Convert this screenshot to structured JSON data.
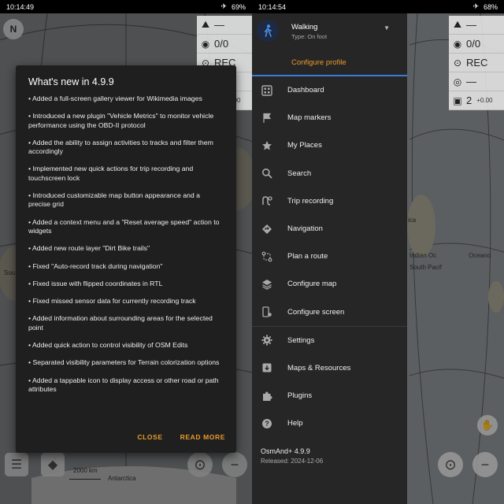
{
  "left": {
    "status": {
      "time": "10:14:49",
      "battery": "69%"
    },
    "widgets": [
      {
        "icon": "altitude-icon",
        "value": "—",
        "small": ""
      },
      {
        "icon": "distance-icon",
        "value": "0/0",
        "small": ""
      },
      {
        "icon": "record-icon",
        "value": "REC",
        "small": ""
      },
      {
        "icon": "time-icon",
        "value": "—",
        "small": ""
      },
      {
        "icon": "layers-icon",
        "value": "2",
        "small": "+0.00"
      }
    ],
    "compass": "N",
    "map_labels": {
      "antarctica": "Antarctica",
      "scale": "2000 km",
      "south": "Sou"
    },
    "dialog": {
      "title": "What's new in 4.9.9",
      "items": [
        "• Added a full-screen gallery viewer for Wikimedia images",
        "• Introduced a new plugin \"Vehicle Metrics\" to monitor vehicle performance using the OBD-II protocol",
        "• Added the ability to assign activities to tracks and filter them accordingly",
        "• Implemented new quick actions for trip recording and touchscreen lock",
        "• Introduced customizable map button appearance and a precise grid",
        "• Added a context menu and a \"Reset average speed\" action to widgets",
        "• Added new route layer \"Dirt Bike trails\"",
        "• Fixed \"Auto-record track during navigation\"",
        "• Fixed issue with flipped coordinates in RTL",
        "• Fixed missed sensor data for currently recording track",
        "• Added information about surrounding areas for the selected point",
        "• Added quick action to control visibility of OSM Edits",
        "• Separated visibility parameters for Terrain colorization options",
        "• Added a tappable icon to display access or other road or path attributes"
      ],
      "close_label": "CLOSE",
      "read_more_label": "READ MORE"
    }
  },
  "right": {
    "status": {
      "time": "10:14:54",
      "battery": "68%"
    },
    "profile": {
      "name": "Walking",
      "type": "Type: On foot",
      "configure": "Configure profile"
    },
    "menu": [
      {
        "label": "Dashboard",
        "icon": "dashboard-icon"
      },
      {
        "label": "Map markers",
        "icon": "flag-icon"
      },
      {
        "label": "My Places",
        "icon": "star-icon"
      },
      {
        "label": "Search",
        "icon": "search-icon"
      },
      {
        "label": "Trip recording",
        "icon": "trip-recording-icon"
      },
      {
        "label": "Navigation",
        "icon": "navigation-icon"
      },
      {
        "label": "Plan a route",
        "icon": "plan-route-icon"
      },
      {
        "label": "Configure map",
        "icon": "layers-icon"
      },
      {
        "label": "Configure screen",
        "icon": "configure-screen-icon"
      },
      {
        "label": "Settings",
        "icon": "gear-icon"
      },
      {
        "label": "Maps & Resources",
        "icon": "download-icon"
      },
      {
        "label": "Plugins",
        "icon": "puzzle-icon"
      },
      {
        "label": "Help",
        "icon": "help-icon"
      }
    ],
    "app": {
      "version": "OsmAnd+ 4.9.9",
      "released": "Released: 2024-12-06"
    },
    "widgets": [
      {
        "icon": "altitude-icon",
        "value": "—",
        "small": ""
      },
      {
        "icon": "distance-icon",
        "value": "0/0",
        "small": ""
      },
      {
        "icon": "record-icon",
        "value": "REC",
        "small": ""
      },
      {
        "icon": "time-icon",
        "value": "—",
        "small": ""
      },
      {
        "icon": "layers-icon",
        "value": "2",
        "small": "+0.00"
      }
    ],
    "map_labels": {
      "africa": "ica",
      "ocean": "Indian Oc",
      "ocean2": "Oceano",
      "south": "South Pacif"
    }
  },
  "colors": {
    "accent": "#e99a2c",
    "divider_blue": "#3a7bd5",
    "dialog_bg": "#1f1f1f",
    "drawer_bg": "#262626"
  }
}
